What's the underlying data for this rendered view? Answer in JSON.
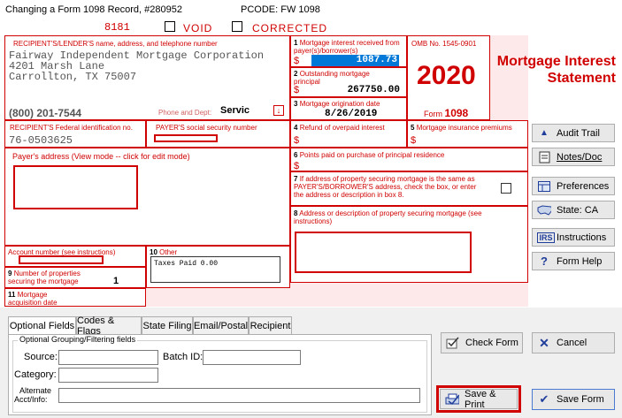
{
  "window": {
    "title": "Changing a Form 1098 Record, #280952",
    "pcode": "PCODE: FW 1098"
  },
  "header": {
    "code": "8181",
    "void_label": "VOID",
    "corrected_label": "CORRECTED"
  },
  "recipient": {
    "label": "RECIPIENT'S/LENDER'S name, address, and telephone number",
    "name": "Fairway Independent Mortgage Corporation",
    "address": "4201 Marsh Lane",
    "city": "Carrollton, TX 75007",
    "phone": "(800) 201-7544",
    "phone_dept_label": "Phone and Dept:",
    "phone_dept_value": "Servic"
  },
  "box1": {
    "num": "1",
    "label": "Mortgage interest received from payer(s)/borrower(s)",
    "dollar": "$",
    "value": "1087.73"
  },
  "box2": {
    "num": "2",
    "label": "Outstanding mortgage principal",
    "dollar": "$",
    "value": "267750.00"
  },
  "box3": {
    "num": "3",
    "label": "Mortgage origination date",
    "value": "8/26/2019"
  },
  "omb": {
    "label": "OMB No. 1545-0901",
    "year": "2020",
    "form_label": "Form",
    "form_number": "1098"
  },
  "form_title": "Mortgage Interest Statement",
  "fed_id": {
    "label": "RECIPIENT'S Federal identification no.",
    "value": "76-0503625"
  },
  "payer_ssn": {
    "label": "PAYER'S social security number"
  },
  "box4": {
    "num": "4",
    "label": "Refund of overpaid interest",
    "dollar": "$"
  },
  "box5": {
    "num": "5",
    "label": "Mortgage insurance premiums",
    "dollar": "$"
  },
  "payer_address": {
    "label": "Payer's address (View mode -- click for edit mode)"
  },
  "box6": {
    "num": "6",
    "label": "Points paid on purchase of principal residence",
    "dollar": "$"
  },
  "box7": {
    "num": "7",
    "label": "If address of property securing mortgage is the same as PAYER'S/BORROWER'S address, check the box, or enter the address or description in box 8."
  },
  "box8": {
    "num": "8",
    "label": "Address or description of property securing mortgage (see instructions)"
  },
  "account": {
    "label": "Account number (see instructions)"
  },
  "box9": {
    "num": "9",
    "label": "Number of properties securing the mortgage",
    "value": "1"
  },
  "box10": {
    "num": "10",
    "label": "Other",
    "value": "Taxes Paid 0.00"
  },
  "box11": {
    "num": "11",
    "label": "Mortgage acquisition date"
  },
  "side_buttons": {
    "audit_trail": "Audit Trail",
    "notes": "Notes/Doc",
    "preferences": "Preferences",
    "state": "State: CA",
    "instructions": "Instructions",
    "form_help": "Form Help"
  },
  "tabs": [
    "Optional Fields",
    "Codes & Flags",
    "State Filing",
    "Email/Postal",
    "Recipient"
  ],
  "optional": {
    "group_label": "Optional Grouping/Filtering fields",
    "source_label": "Source:",
    "batch_label": "Batch ID:",
    "category_label": "Category:",
    "alt_label_1": "Alternate",
    "alt_label_2": "Acct/Info:"
  },
  "actions": {
    "check_form": "Check Form",
    "cancel": "Cancel",
    "save_print": "Save & Print",
    "save_form": "Save Form"
  },
  "colors": {
    "form_red": "#d00000",
    "highlight": "#0078d7",
    "panel": "#f0f0f0"
  }
}
